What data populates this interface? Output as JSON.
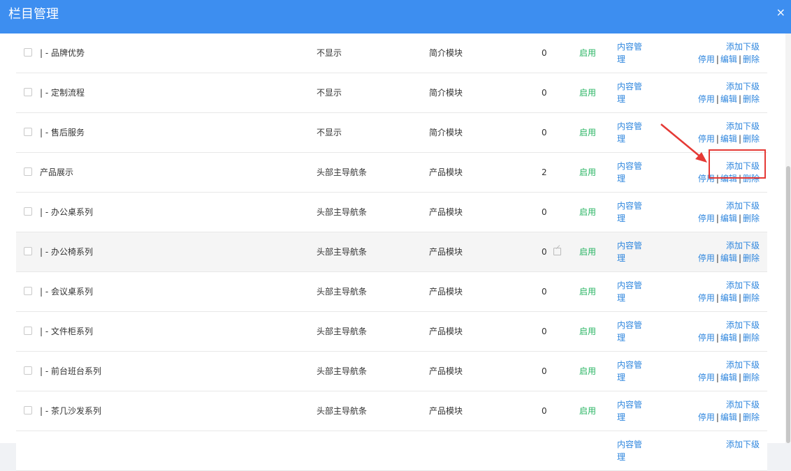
{
  "window": {
    "title": "栏目管理",
    "close_icon": "×"
  },
  "rows": [
    {
      "name": "| - 品牌优势",
      "nav": "不显示",
      "module": "简介模块",
      "sort": "0",
      "status": "启用",
      "content_link": "内容管理",
      "add_child": "添加下级",
      "disable": "停用",
      "edit": "编辑",
      "delete": "删除"
    },
    {
      "name": "| - 定制流程",
      "nav": "不显示",
      "module": "简介模块",
      "sort": "0",
      "status": "启用",
      "content_link": "内容管理",
      "add_child": "添加下级",
      "disable": "停用",
      "edit": "编辑",
      "delete": "删除"
    },
    {
      "name": "| - 售后服务",
      "nav": "不显示",
      "module": "简介模块",
      "sort": "0",
      "status": "启用",
      "content_link": "内容管理",
      "add_child": "添加下级",
      "disable": "停用",
      "edit": "编辑",
      "delete": "删除"
    },
    {
      "name": "产品展示",
      "nav": "头部主导航条",
      "module": "产品模块",
      "sort": "2",
      "status": "启用",
      "content_link": "内容管理",
      "add_child": "添加下级",
      "disable": "停用",
      "edit": "编辑",
      "delete": "删除"
    },
    {
      "name": "| - 办公桌系列",
      "nav": "头部主导航条",
      "module": "产品模块",
      "sort": "0",
      "status": "启用",
      "content_link": "内容管理",
      "add_child": "添加下级",
      "disable": "停用",
      "edit": "编辑",
      "delete": "删除"
    },
    {
      "name": "| - 办公椅系列",
      "nav": "头部主导航条",
      "module": "产品模块",
      "sort": "0",
      "status": "启用",
      "content_link": "内容管理",
      "add_child": "添加下级",
      "disable": "停用",
      "edit": "编辑",
      "delete": "删除"
    },
    {
      "name": "| - 会议桌系列",
      "nav": "头部主导航条",
      "module": "产品模块",
      "sort": "0",
      "status": "启用",
      "content_link": "内容管理",
      "add_child": "添加下级",
      "disable": "停用",
      "edit": "编辑",
      "delete": "删除"
    },
    {
      "name": "| - 文件柜系列",
      "nav": "头部主导航条",
      "module": "产品模块",
      "sort": "0",
      "status": "启用",
      "content_link": "内容管理",
      "add_child": "添加下级",
      "disable": "停用",
      "edit": "编辑",
      "delete": "删除"
    },
    {
      "name": "| - 前台班台系列",
      "nav": "头部主导航条",
      "module": "产品模块",
      "sort": "0",
      "status": "启用",
      "content_link": "内容管理",
      "add_child": "添加下级",
      "disable": "停用",
      "edit": "编辑",
      "delete": "删除"
    },
    {
      "name": "| - 茶几沙发系列",
      "nav": "头部主导航条",
      "module": "产品模块",
      "sort": "0",
      "status": "启用",
      "content_link": "内容管理",
      "add_child": "添加下级",
      "disable": "停用",
      "edit": "编辑",
      "delete": "删除"
    },
    {
      "name": "",
      "nav": "",
      "module": "",
      "sort": "",
      "status": "",
      "content_link": "内容管理",
      "add_child": "添加下级",
      "disable": "",
      "edit": "",
      "delete": ""
    }
  ]
}
